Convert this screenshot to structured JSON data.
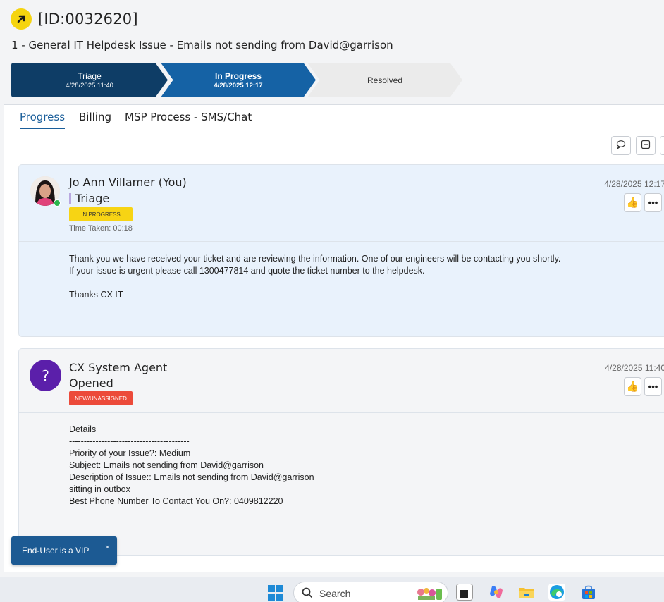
{
  "ticket": {
    "id": "[ID:0032620]",
    "title": "1 - General IT Helpdesk Issue - Emails not sending from David@garrison"
  },
  "stages": [
    {
      "label": "Triage",
      "date": "4/28/2025 11:40"
    },
    {
      "label": "In Progress",
      "date": "4/28/2025 12:17"
    },
    {
      "label": "Resolved",
      "date": ""
    }
  ],
  "tabs": [
    "Progress",
    "Billing",
    "MSP Process - SMS/Chat"
  ],
  "toolbar": {
    "icons": [
      "comment-icon",
      "collapse-icon"
    ]
  },
  "entries": [
    {
      "author": "Jo Ann Villamer (You)",
      "stage": "Triage",
      "badge": "IN PROGRESS",
      "time_taken": "Time Taken: 00:18",
      "date": "4/28/2025 12:17",
      "body": "Thank you we have received your ticket and are reviewing the information. One of our engineers will be contacting you shortly.\nIf your issue is urgent please call 1300477814 and quote the ticket number to the helpdesk.\n\nThanks CX IT"
    },
    {
      "author": "CX System Agent",
      "avatar_glyph": "?",
      "stage": "Opened",
      "badge": "NEW/UNASSIGNED",
      "date": "4/28/2025 11:40",
      "body": "Details\n-----------------------------------------\nPriority of your Issue?: Medium\nSubject: Emails not sending from David@garrison\nDescription of Issue:: Emails not sending from David@garrison\nsitting in outbox\nBest Phone Number To Contact You On?: 0409812220"
    }
  ],
  "vip_notice": {
    "label": "End-User is a VIP",
    "close": "×"
  },
  "taskbar": {
    "search_placeholder": "Search"
  },
  "colors": {
    "accent": "#1a5e9a",
    "stage_dark": "#0e3d66",
    "stage_active": "#1562a5",
    "badge_yellow": "#f7d414",
    "badge_red": "#ec4a3a",
    "agent_avatar": "#5b1faa"
  }
}
